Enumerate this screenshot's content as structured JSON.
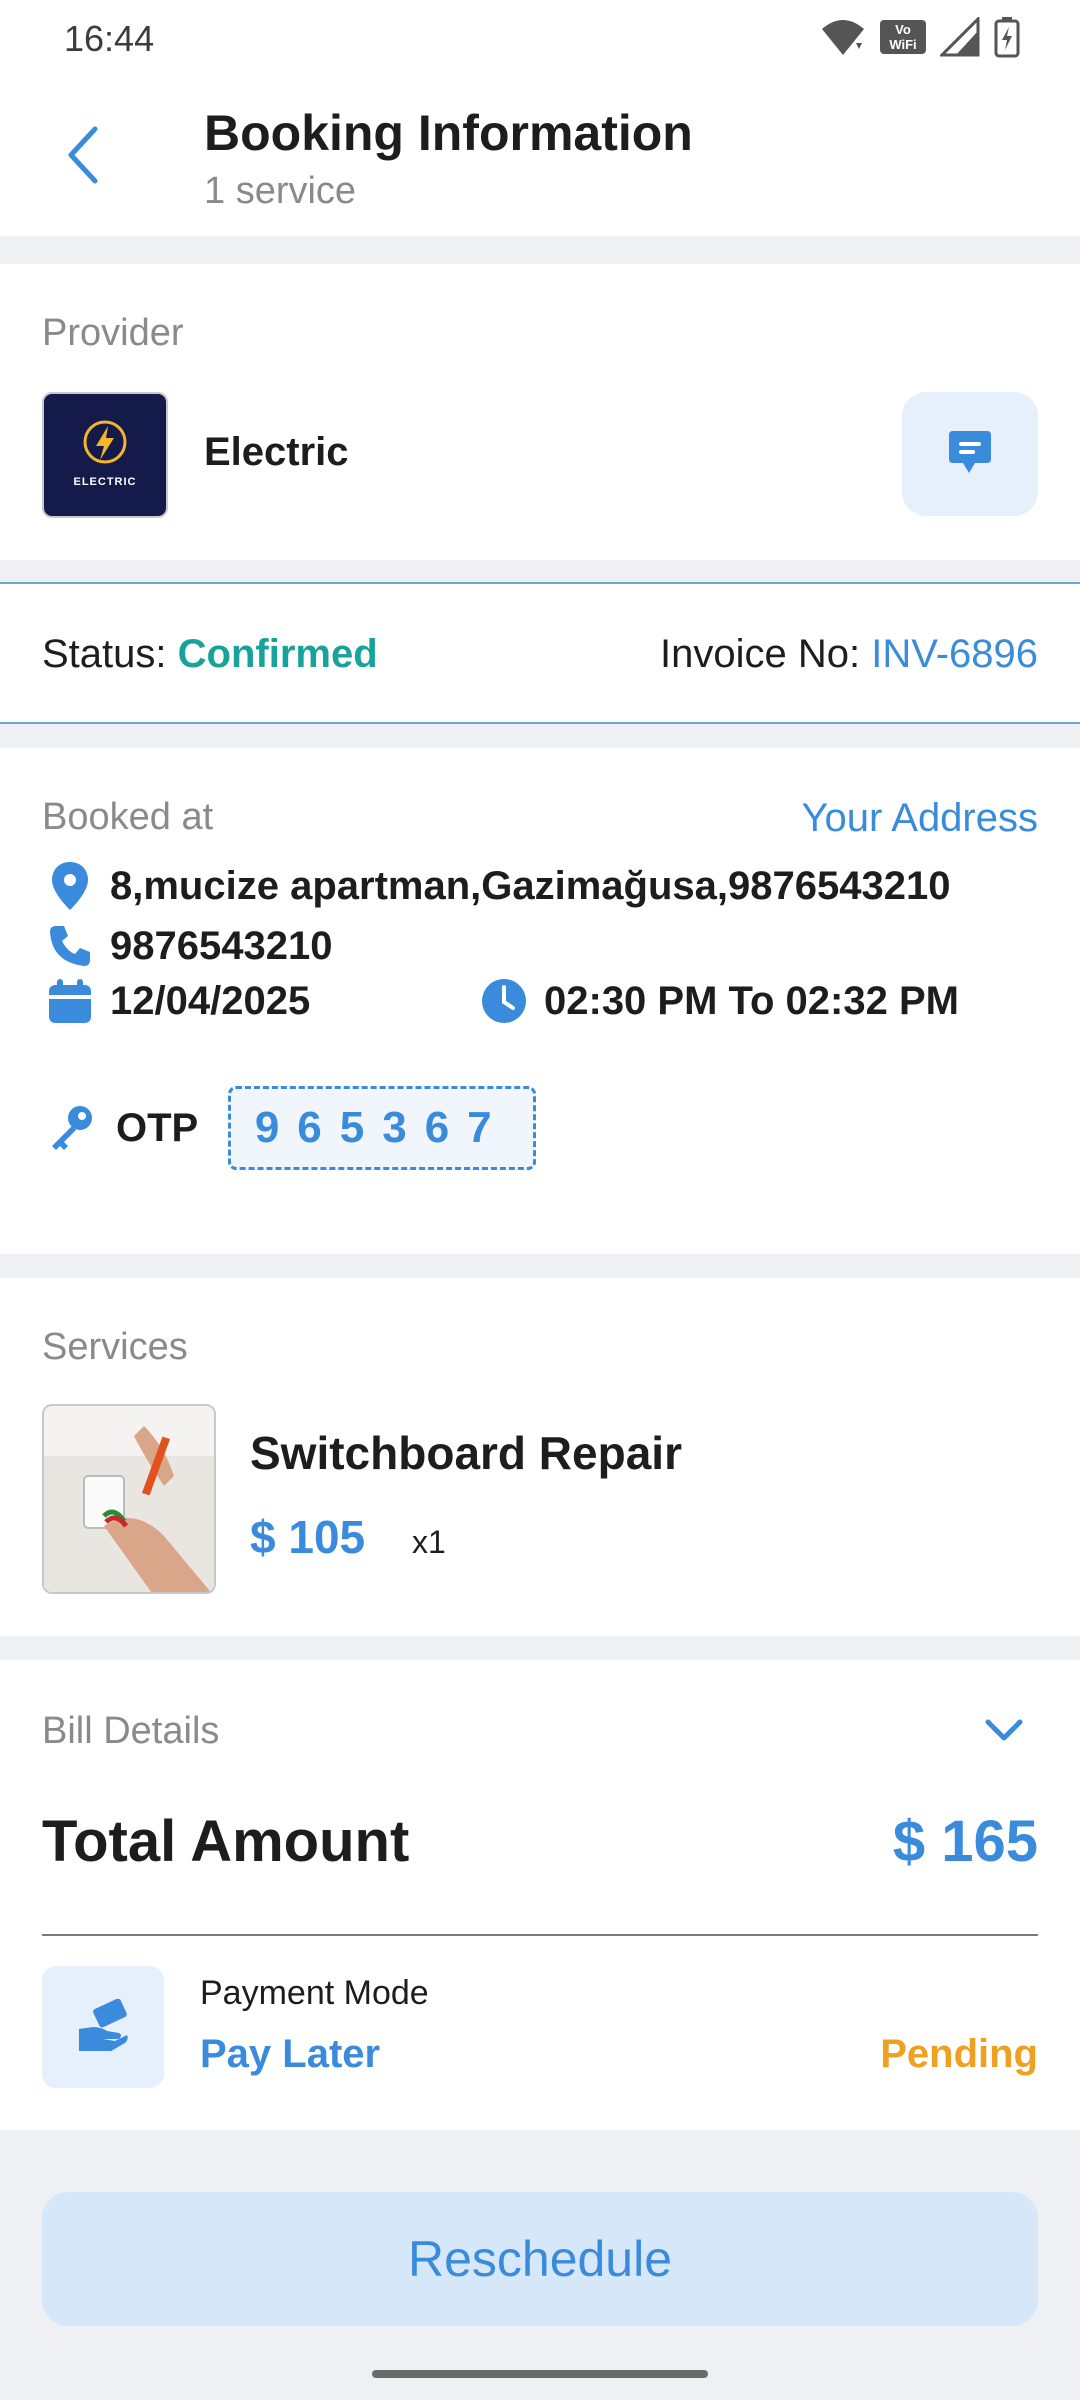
{
  "status_bar": {
    "time": "16:44",
    "volte_line1": "Vo",
    "volte_line2": "WiFi"
  },
  "header": {
    "title": "Booking Information",
    "subtitle": "1 service"
  },
  "provider": {
    "section_label": "Provider",
    "name": "Electric",
    "logo_text": "ELECTRIC"
  },
  "status": {
    "label": "Status:",
    "value": "Confirmed",
    "invoice_label": "Invoice No:",
    "invoice_value": "INV-6896"
  },
  "booking": {
    "section_label": "Booked at",
    "address_link": "Your Address",
    "address": "8,mucize apartman,Gazimağusa,9876543210",
    "phone": "9876543210",
    "date": "12/04/2025",
    "time": "02:30 PM To 02:32 PM",
    "otp_label": "OTP",
    "otp_value": "965367"
  },
  "services": {
    "section_label": "Services",
    "items": [
      {
        "name": "Switchboard Repair",
        "price": "$ 105",
        "qty": "x1"
      }
    ]
  },
  "bill": {
    "section_label": "Bill Details",
    "total_label": "Total Amount",
    "total_value": "$ 165",
    "payment_mode_label": "Payment Mode",
    "payment_mode_value": "Pay Later",
    "payment_status": "Pending"
  },
  "actions": {
    "reschedule": "Reschedule"
  },
  "colors": {
    "accent": "#3a8bdc",
    "confirmed": "#18a39a",
    "pending": "#f0a020",
    "background": "#eef0f4"
  }
}
